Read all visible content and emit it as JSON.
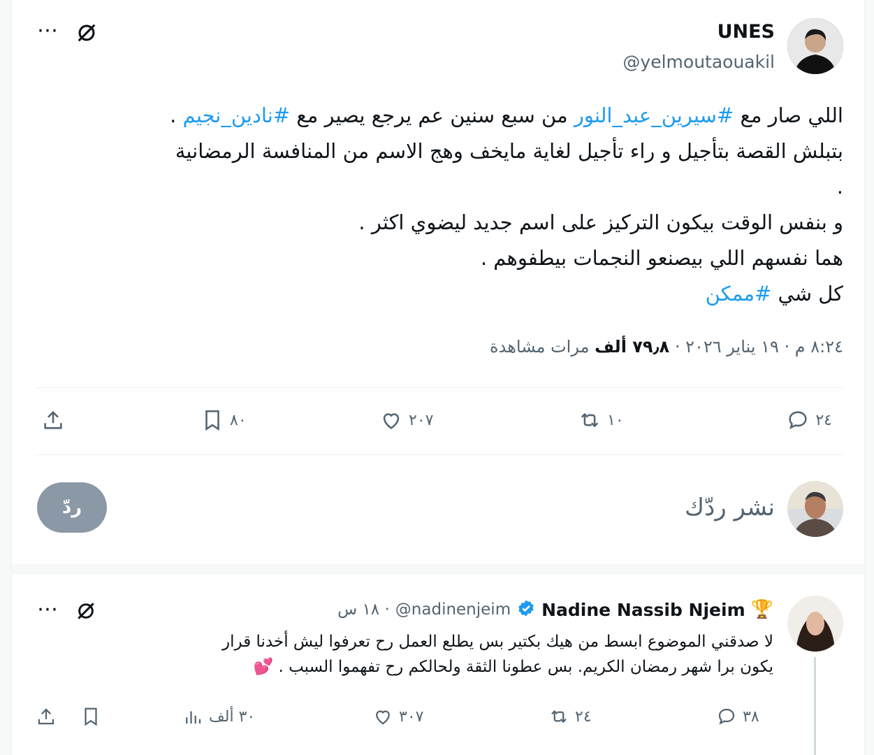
{
  "main": {
    "author_name": "UNES",
    "author_handle": "@yelmoutaouakil",
    "lines": [
      {
        "parts": [
          {
            "t": "اللي صار مع "
          },
          {
            "t": "#سيرين_عبد_النور",
            "tag": true
          },
          {
            "t": " من سبع سنين عم يرجع يصير مع "
          },
          {
            "t": "#نادين_نجيم",
            "tag": true
          },
          {
            "t": " ."
          }
        ]
      },
      {
        "parts": [
          {
            "t": "بتبلش القصة بتأجيل و راء تأجيل لغاية مايخف وهج الاسم من المنافسة الرمضانية"
          }
        ]
      },
      {
        "parts": [
          {
            "t": "."
          }
        ]
      },
      {
        "parts": [
          {
            "t": "و بنفس الوقت بيكون التركيز على اسم جديد ليضوي اكثر ."
          }
        ]
      },
      {
        "parts": [
          {
            "t": "هما نفسهم اللي بيصنعو النجمات بيطفوهم ."
          }
        ]
      },
      {
        "parts": [
          {
            "t": "كل شي "
          },
          {
            "t": "#ممكن",
            "tag": true
          }
        ]
      }
    ],
    "timestamp": "٨:٢٤ م · ١٩ يناير ٢٠٢٦ · ",
    "views_count": "٧٩٫٨ ألف",
    "views_label": "مرات مشاهدة",
    "stats": {
      "replies": "٢٤",
      "retweets": "١٠",
      "likes": "٢٠٧",
      "bookmarks": "٨٠"
    }
  },
  "composer": {
    "placeholder": "نشر ردّك",
    "button_label": "ردّ"
  },
  "reply": {
    "badge": "🏆",
    "author_name": "Nadine Nassib Njeim",
    "author_handle": "@nadinenjeim",
    "time": "· ١٨ س",
    "line1": "لا صدقني الموضوع ابسط من هيك بكتير بس يطلع العمل رح تعرفوا ليش أخدنا قرار",
    "line2": "يكون برا شهر رمضان الكريم. بس عطونا الثقة ولحالكم رح تفهموا السبب . 💕",
    "stats": {
      "replies": "٣٨",
      "retweets": "٢٤",
      "likes": "٣٠٧",
      "views": "٣٠ ألف"
    }
  },
  "colors": {
    "accent": "#1d9bf0",
    "muted": "#536471",
    "button": "#8b98a5"
  },
  "icons": [
    "more-icon",
    "grok-icon",
    "reply-icon",
    "retweet-icon",
    "like-icon",
    "bookmark-icon",
    "share-icon",
    "views-icon",
    "verified-icon"
  ]
}
